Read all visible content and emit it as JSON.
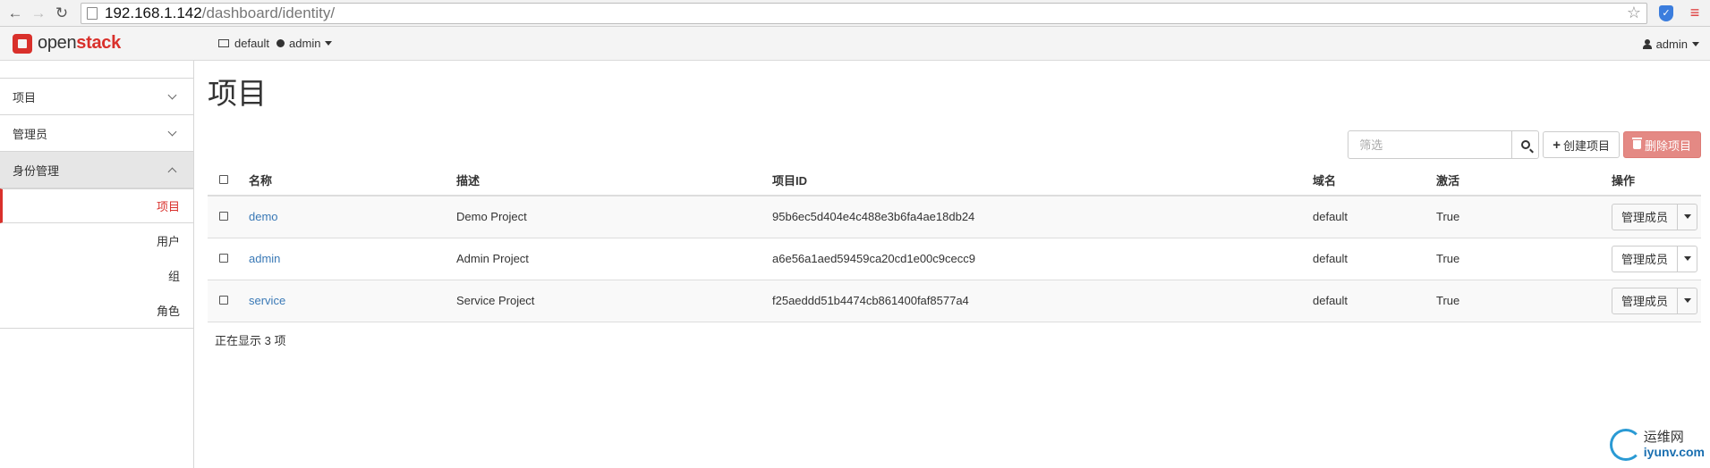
{
  "browser": {
    "back_glyph": "←",
    "forward_glyph": "→",
    "reload_glyph": "↻",
    "url_host": "192.168.1.142",
    "url_path": "/dashboard/identity/",
    "star_glyph": "☆",
    "menu_glyph": "≡"
  },
  "topnav": {
    "brand_open": "open",
    "brand_stack": "stack",
    "domain": "default",
    "project": "admin",
    "user": "admin"
  },
  "sidebar": {
    "groups": [
      {
        "label": "项目"
      },
      {
        "label": "管理员"
      },
      {
        "label": "身份管理"
      }
    ],
    "identity_items": [
      {
        "label": "项目"
      },
      {
        "label": "用户"
      },
      {
        "label": "组"
      },
      {
        "label": "角色"
      }
    ]
  },
  "main": {
    "title": "项目",
    "filter_placeholder": "筛选",
    "create_label": "创建项目",
    "delete_label": "删除项目",
    "columns": [
      "名称",
      "描述",
      "项目ID",
      "域名",
      "激活",
      "操作"
    ],
    "rows": [
      {
        "name": "demo",
        "description": "Demo Project",
        "id": "95b6ec5d404e4c488e3b6fa4ae18db24",
        "domain": "default",
        "enabled": "True",
        "action": "管理成员"
      },
      {
        "name": "admin",
        "description": "Admin Project",
        "id": "a6e56a1aed59459ca20cd1e00c9cecc9",
        "domain": "default",
        "enabled": "True",
        "action": "管理成员"
      },
      {
        "name": "service",
        "description": "Service Project",
        "id": "f25aeddd51b4474cb861400faf8577a4",
        "domain": "default",
        "enabled": "True",
        "action": "管理成员"
      }
    ],
    "count_text": "正在显示 3 项"
  },
  "watermark": {
    "cn": "运维网",
    "en": "iyunv.com"
  },
  "colors": {
    "brand_red": "#d9302b",
    "link_blue": "#3a79b6",
    "danger_button": "#e48984"
  }
}
